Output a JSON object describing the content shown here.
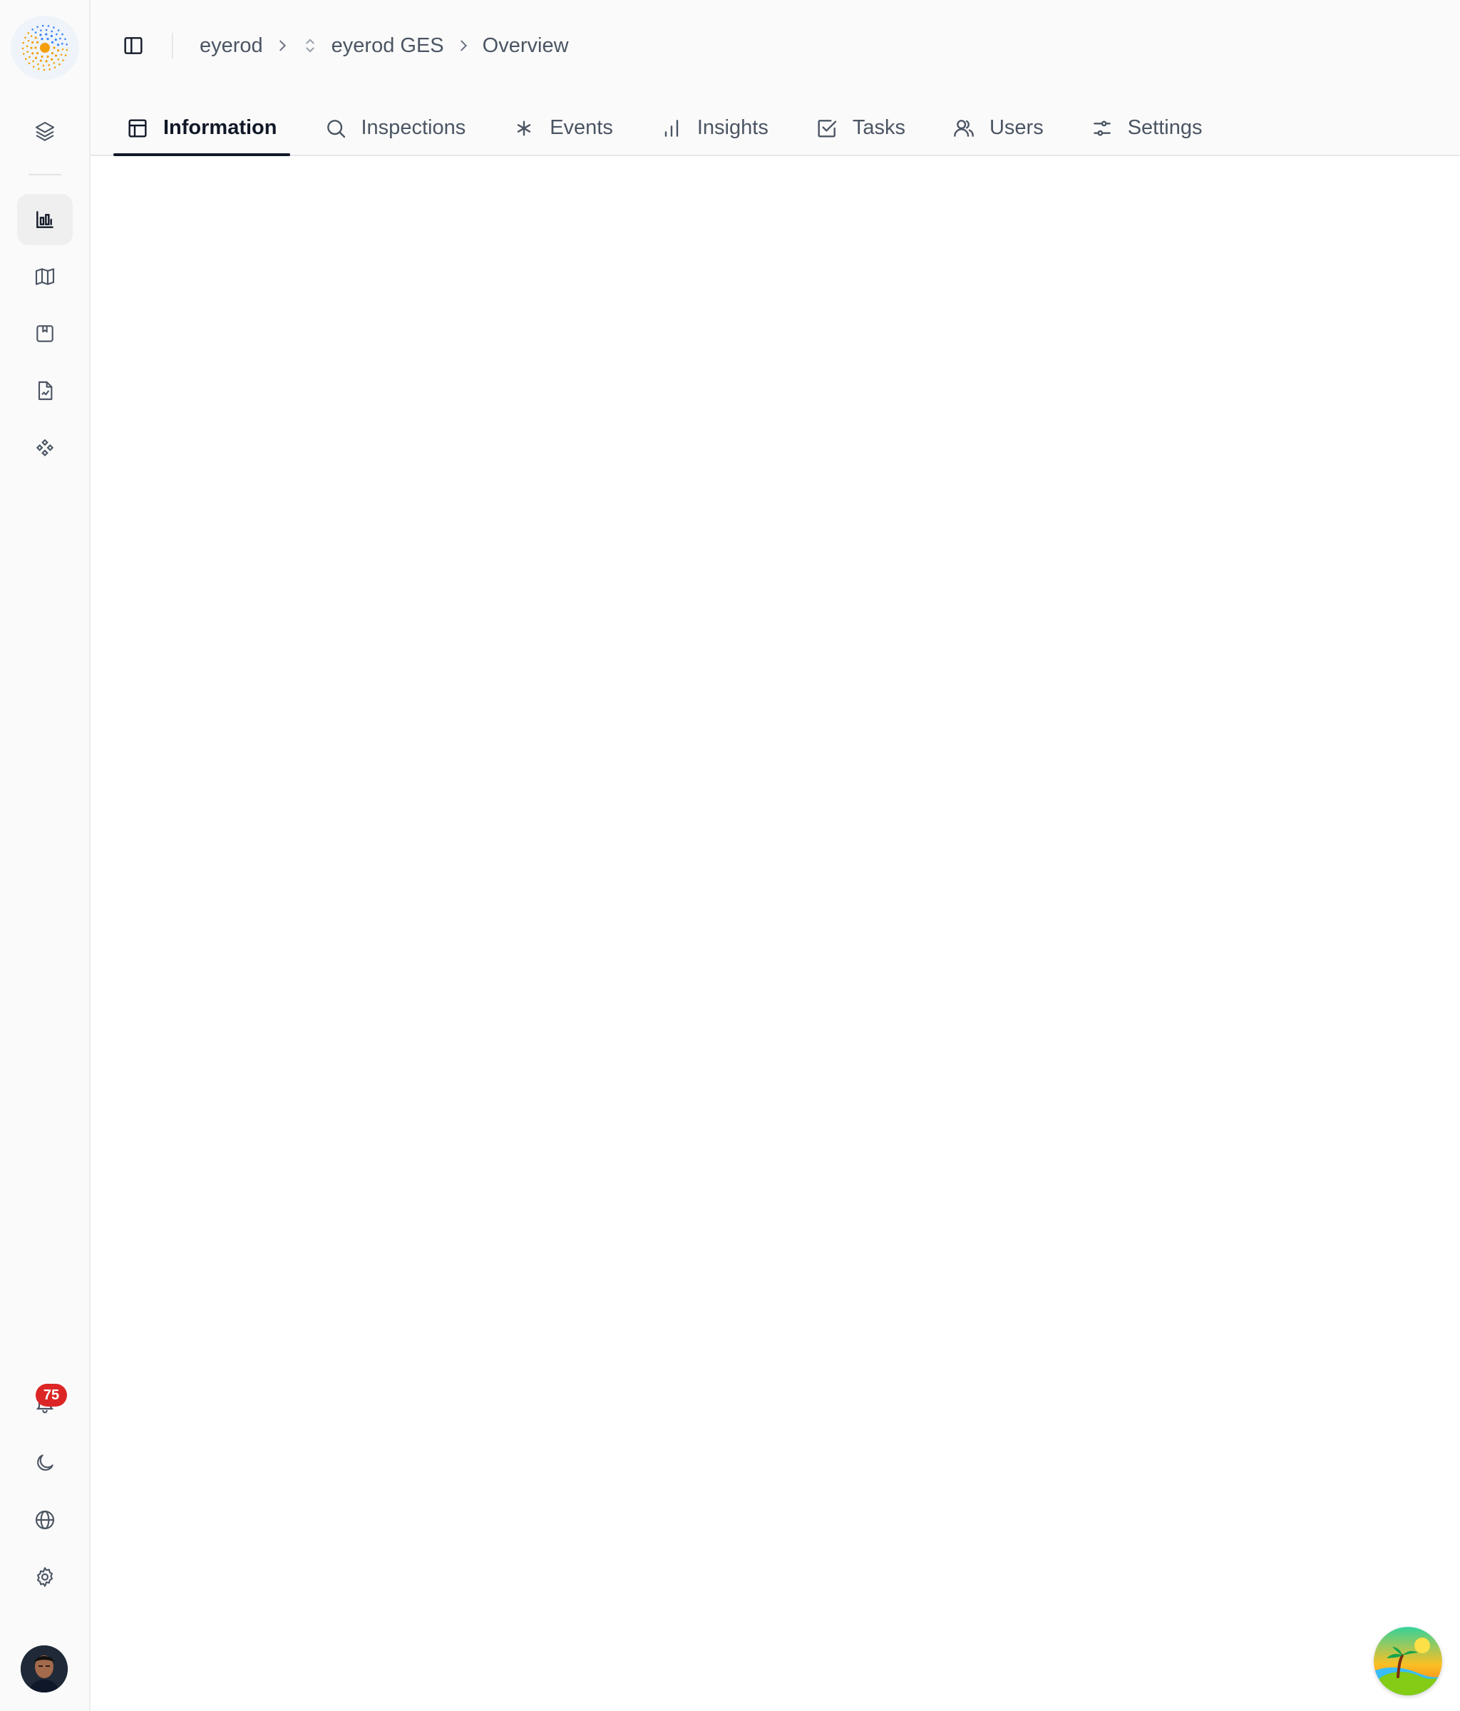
{
  "rail": {
    "notifications_count": "75",
    "top_icons": [
      "layers-icon",
      "bar-chart-icon",
      "map-icon",
      "bookmark-box-icon",
      "file-chart-icon",
      "components-icon"
    ],
    "bottom_icons": [
      "bell-icon",
      "moon-icon",
      "globe-icon",
      "gear-icon"
    ]
  },
  "breadcrumb": {
    "org": "eyerod",
    "site": "eyerod GES",
    "page": "Overview"
  },
  "tabs": [
    {
      "label": "Information",
      "icon": "layout-icon",
      "active": true
    },
    {
      "label": "Inspections",
      "icon": "search-icon",
      "active": false
    },
    {
      "label": "Events",
      "icon": "asterisk-icon",
      "active": false
    },
    {
      "label": "Insights",
      "icon": "signal-bars-icon",
      "active": false
    },
    {
      "label": "Tasks",
      "icon": "checkbox-icon",
      "active": false
    },
    {
      "label": "Users",
      "icon": "users-icon",
      "active": false
    },
    {
      "label": "Settings",
      "icon": "sliders-icon",
      "active": false
    }
  ],
  "colors": {
    "accent": "#111827",
    "badge": "#dc2626",
    "muted_text": "#4b5563",
    "logo_orange": "#f59e0b",
    "logo_blue": "#3b82f6"
  }
}
